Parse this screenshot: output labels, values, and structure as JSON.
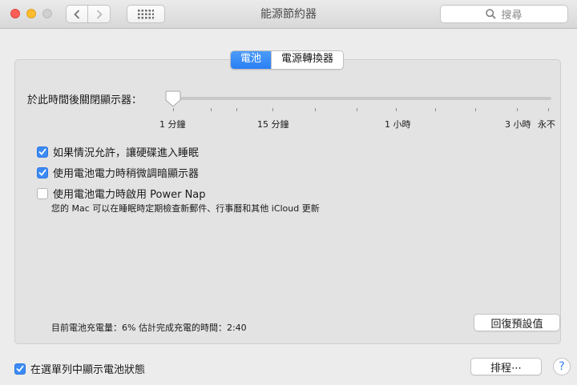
{
  "window": {
    "title": "能源節約器"
  },
  "toolbar": {
    "search_placeholder": "搜尋"
  },
  "tabs": [
    {
      "label": "電池",
      "selected": true
    },
    {
      "label": "電源轉換器",
      "selected": false
    }
  ],
  "display_sleep": {
    "label": "於此時間後關閉顯示器：",
    "value": "1 分鐘",
    "tick_labels": [
      "1 分鐘",
      "15 分鐘",
      "1 小時",
      "3 小時",
      "永不"
    ]
  },
  "options": [
    {
      "label": "如果情況允許，讓硬碟進入睡眠",
      "checked": true
    },
    {
      "label": "使用電池電力時稍微調暗顯示器",
      "checked": true
    },
    {
      "label": "使用電池電力時啟用 Power Nap",
      "checked": false
    }
  ],
  "power_nap_note": "您的 Mac 可以在睡眠時定期檢查新郵件、行事曆和其他 iCloud 更新",
  "battery_status": "目前電池充電量：6%  估計完成充電的時間：2:40",
  "buttons": {
    "restore_defaults": "回復預設值",
    "schedule": "排程⋯",
    "help": "?"
  },
  "menu_bar_option": {
    "label": "在選單列中顯示電池狀態",
    "checked": true
  },
  "colors": {
    "accent": "#2a7ff3",
    "close": "#fc5f57",
    "minimize": "#fdbc2e"
  }
}
